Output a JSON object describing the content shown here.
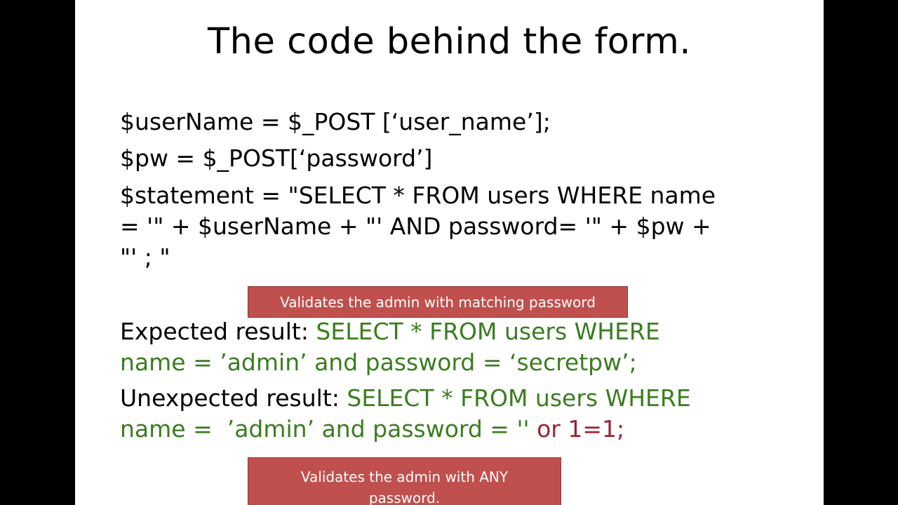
{
  "slide": {
    "title": "The code behind the form.",
    "code_lines": {
      "line1": "$userName = $_POST [‘user_name’];",
      "line2": "$pw = $_POST[‘password’]",
      "statement_line1": "$statement = \"SELECT * FROM users WHERE name",
      "statement_line2": "= '\" + $userName + \"' AND password= '\"   + $pw +",
      "statement_line3": "\"' ; \""
    },
    "callout_expected": "Validates the admin with matching password",
    "expected": {
      "label": "Expected result: ",
      "sql_line1": "SELECT * FROM users WHERE",
      "sql_line2": "name = ’admin’ and password = ‘secretpw’;"
    },
    "unexpected": {
      "label": "Unexpected result: ",
      "sql_line1": "SELECT * FROM users WHERE",
      "sql_line2_green": "name =  ’admin’ and password = '' ",
      "sql_line2_red": "or 1=1;"
    },
    "callout_unexpected_line1": "Validates the admin with ANY",
    "callout_unexpected_line2": "password.",
    "colors": {
      "sql_green": "#3a7d1f",
      "injection_red": "#9b2335",
      "callout_fill": "#c0504d"
    }
  }
}
